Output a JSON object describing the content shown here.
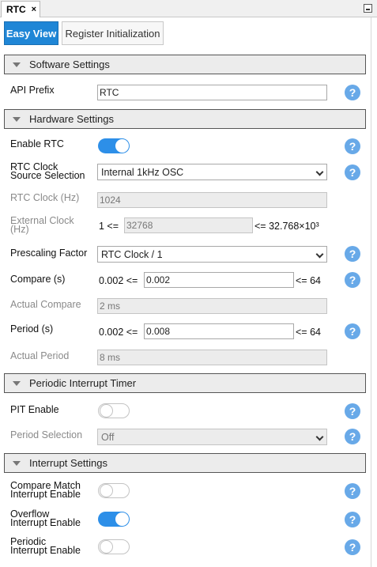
{
  "doc_tab": {
    "title": "RTC",
    "close_glyph": "×"
  },
  "view_tabs": {
    "easy_view": "Easy View",
    "register_init": "Register Initialization"
  },
  "software": {
    "header": "Software Settings",
    "api_prefix": {
      "label": "API Prefix",
      "value": "RTC"
    }
  },
  "hardware": {
    "header": "Hardware Settings",
    "enable_rtc": {
      "label": "Enable RTC",
      "on": true
    },
    "clock_source": {
      "label_line1": "RTC Clock",
      "label_line2": "Source Selection",
      "value": "Internal 1kHz OSC"
    },
    "rtc_clock": {
      "label": "RTC Clock (Hz)",
      "value": "1024"
    },
    "external_clock": {
      "label_line1": "External Clock",
      "label_line2": "(Hz)",
      "min_text": "1 <=",
      "value": "32768",
      "max_text": "<= 32.768×10³"
    },
    "prescaling": {
      "label": "Prescaling Factor",
      "value": "RTC Clock / 1"
    },
    "compare": {
      "label": "Compare (s)",
      "min_text": "0.002 <=",
      "value": "0.002",
      "max_text": "<= 64"
    },
    "actual_compare": {
      "label": "Actual Compare",
      "value": "2 ms"
    },
    "period": {
      "label": "Period (s)",
      "min_text": "0.002 <=",
      "value": "0.008",
      "max_text": "<= 64"
    },
    "actual_period": {
      "label": "Actual Period",
      "value": "8 ms"
    }
  },
  "pit": {
    "header": "Periodic Interrupt Timer",
    "pit_enable": {
      "label": "PIT Enable",
      "on": false
    },
    "period_selection": {
      "label": "Period Selection",
      "value": "Off"
    }
  },
  "interrupts": {
    "header": "Interrupt Settings",
    "compare_match": {
      "label_line1": "Compare Match",
      "label_line2": "Interrupt Enable",
      "on": false
    },
    "overflow": {
      "label_line1": "Overflow",
      "label_line2": "Interrupt Enable",
      "on": true
    },
    "periodic": {
      "label_line1": "Periodic",
      "label_line2": "Interrupt Enable",
      "on": false
    }
  },
  "help_glyph": "?",
  "colors": {
    "accent": "#1f86d6",
    "toggle_on": "#2d8fe8",
    "help": "#68a9e8"
  }
}
